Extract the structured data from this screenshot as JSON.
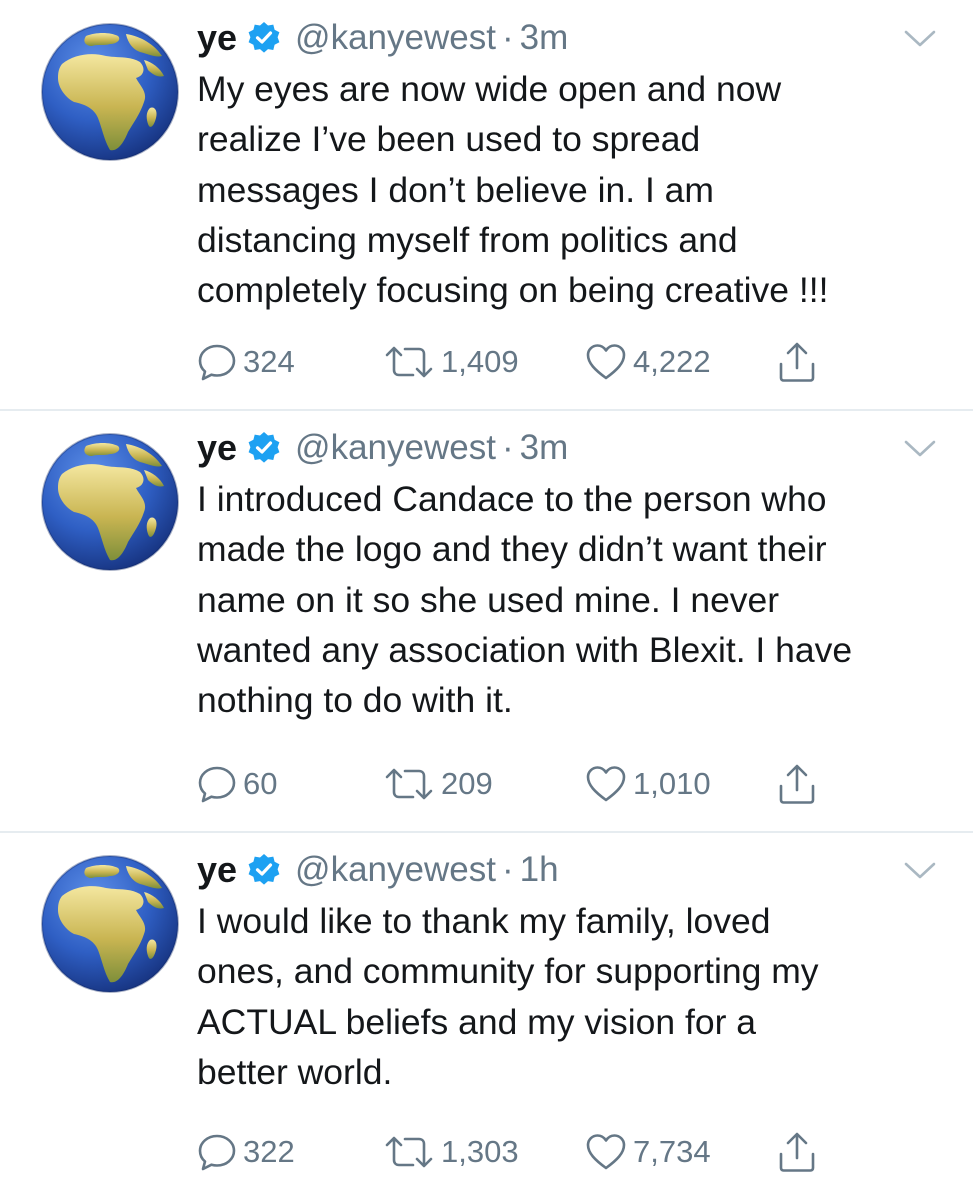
{
  "colors": {
    "text": "#14171a",
    "secondary": "#657786",
    "verified": "#1da1f2",
    "divider": "#e6ecf0"
  },
  "icons": {
    "avatar": "globe-africa-icon",
    "verified": "verified-badge-icon",
    "menu": "chevron-down-icon",
    "reply": "reply-icon",
    "retweet": "retweet-icon",
    "like": "heart-icon",
    "share": "share-icon"
  },
  "tweets": [
    {
      "name": "ye",
      "handle": "@kanyewest",
      "separator": "·",
      "time": "3m",
      "text": "My eyes are now wide open and now\nrealize I’ve been used to spread\nmessages I don’t believe in. I am\ndistancing myself from politics and\ncompletely focusing on being creative !!!",
      "replies": "324",
      "retweets": "1,409",
      "likes": "4,222"
    },
    {
      "name": "ye",
      "handle": "@kanyewest",
      "separator": "·",
      "time": "3m",
      "text": "I introduced Candace to the person who\nmade the logo and they didn’t want their\nname on it so she used mine. I never\nwanted any association with Blexit. I have\nnothing to do with it.",
      "replies": "60",
      "retweets": "209",
      "likes": "1,010"
    },
    {
      "name": "ye",
      "handle": "@kanyewest",
      "separator": "·",
      "time": "1h",
      "text": "I would like to thank my family, loved\nones, and community for supporting my\nACTUAL beliefs and my vision for a\nbetter world.",
      "replies": "322",
      "retweets": "1,303",
      "likes": "7,734"
    }
  ]
}
